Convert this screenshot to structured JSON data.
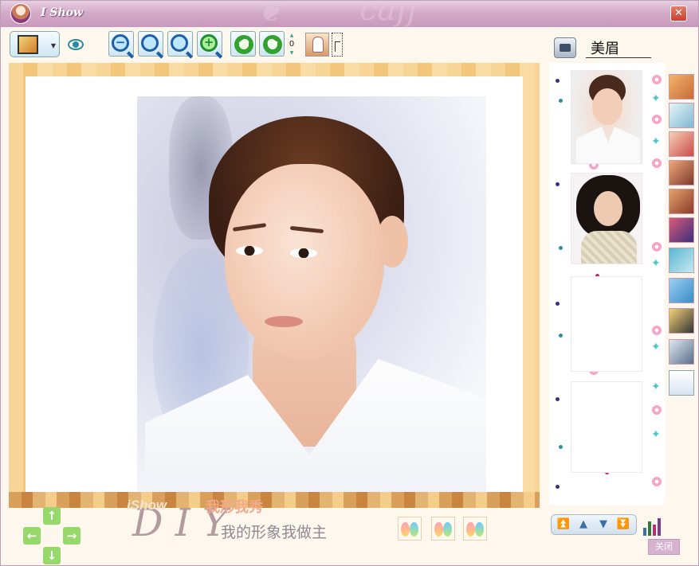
{
  "window": {
    "title": "I Show",
    "close_glyph": "✕"
  },
  "toolbar": {
    "frame_tool_icon": "frame-icon",
    "eye_icon": "eye-icon",
    "zoom_out_icon": "zoom-out-icon",
    "zoom_fit_icon": "zoom-fit-icon",
    "zoom_actual_icon": "zoom-actual-icon",
    "zoom_in_icon": "zoom-in-icon",
    "rotate_icon": "rotate-icon",
    "refresh_icon": "refresh-icon",
    "rotation_value": "0",
    "portrait_icon": "portrait-icon"
  },
  "branding": {
    "logo": "iShow",
    "slogan_big": "我形我秀",
    "diy": "D I Y",
    "slogan_small": "我的形象我做主"
  },
  "album": {
    "title": "美眉"
  },
  "controls": {
    "close_label": "关闭"
  },
  "colors": {
    "accent": "#c899bd",
    "frame": "#f6cd83",
    "arrows": "#96d86a"
  }
}
